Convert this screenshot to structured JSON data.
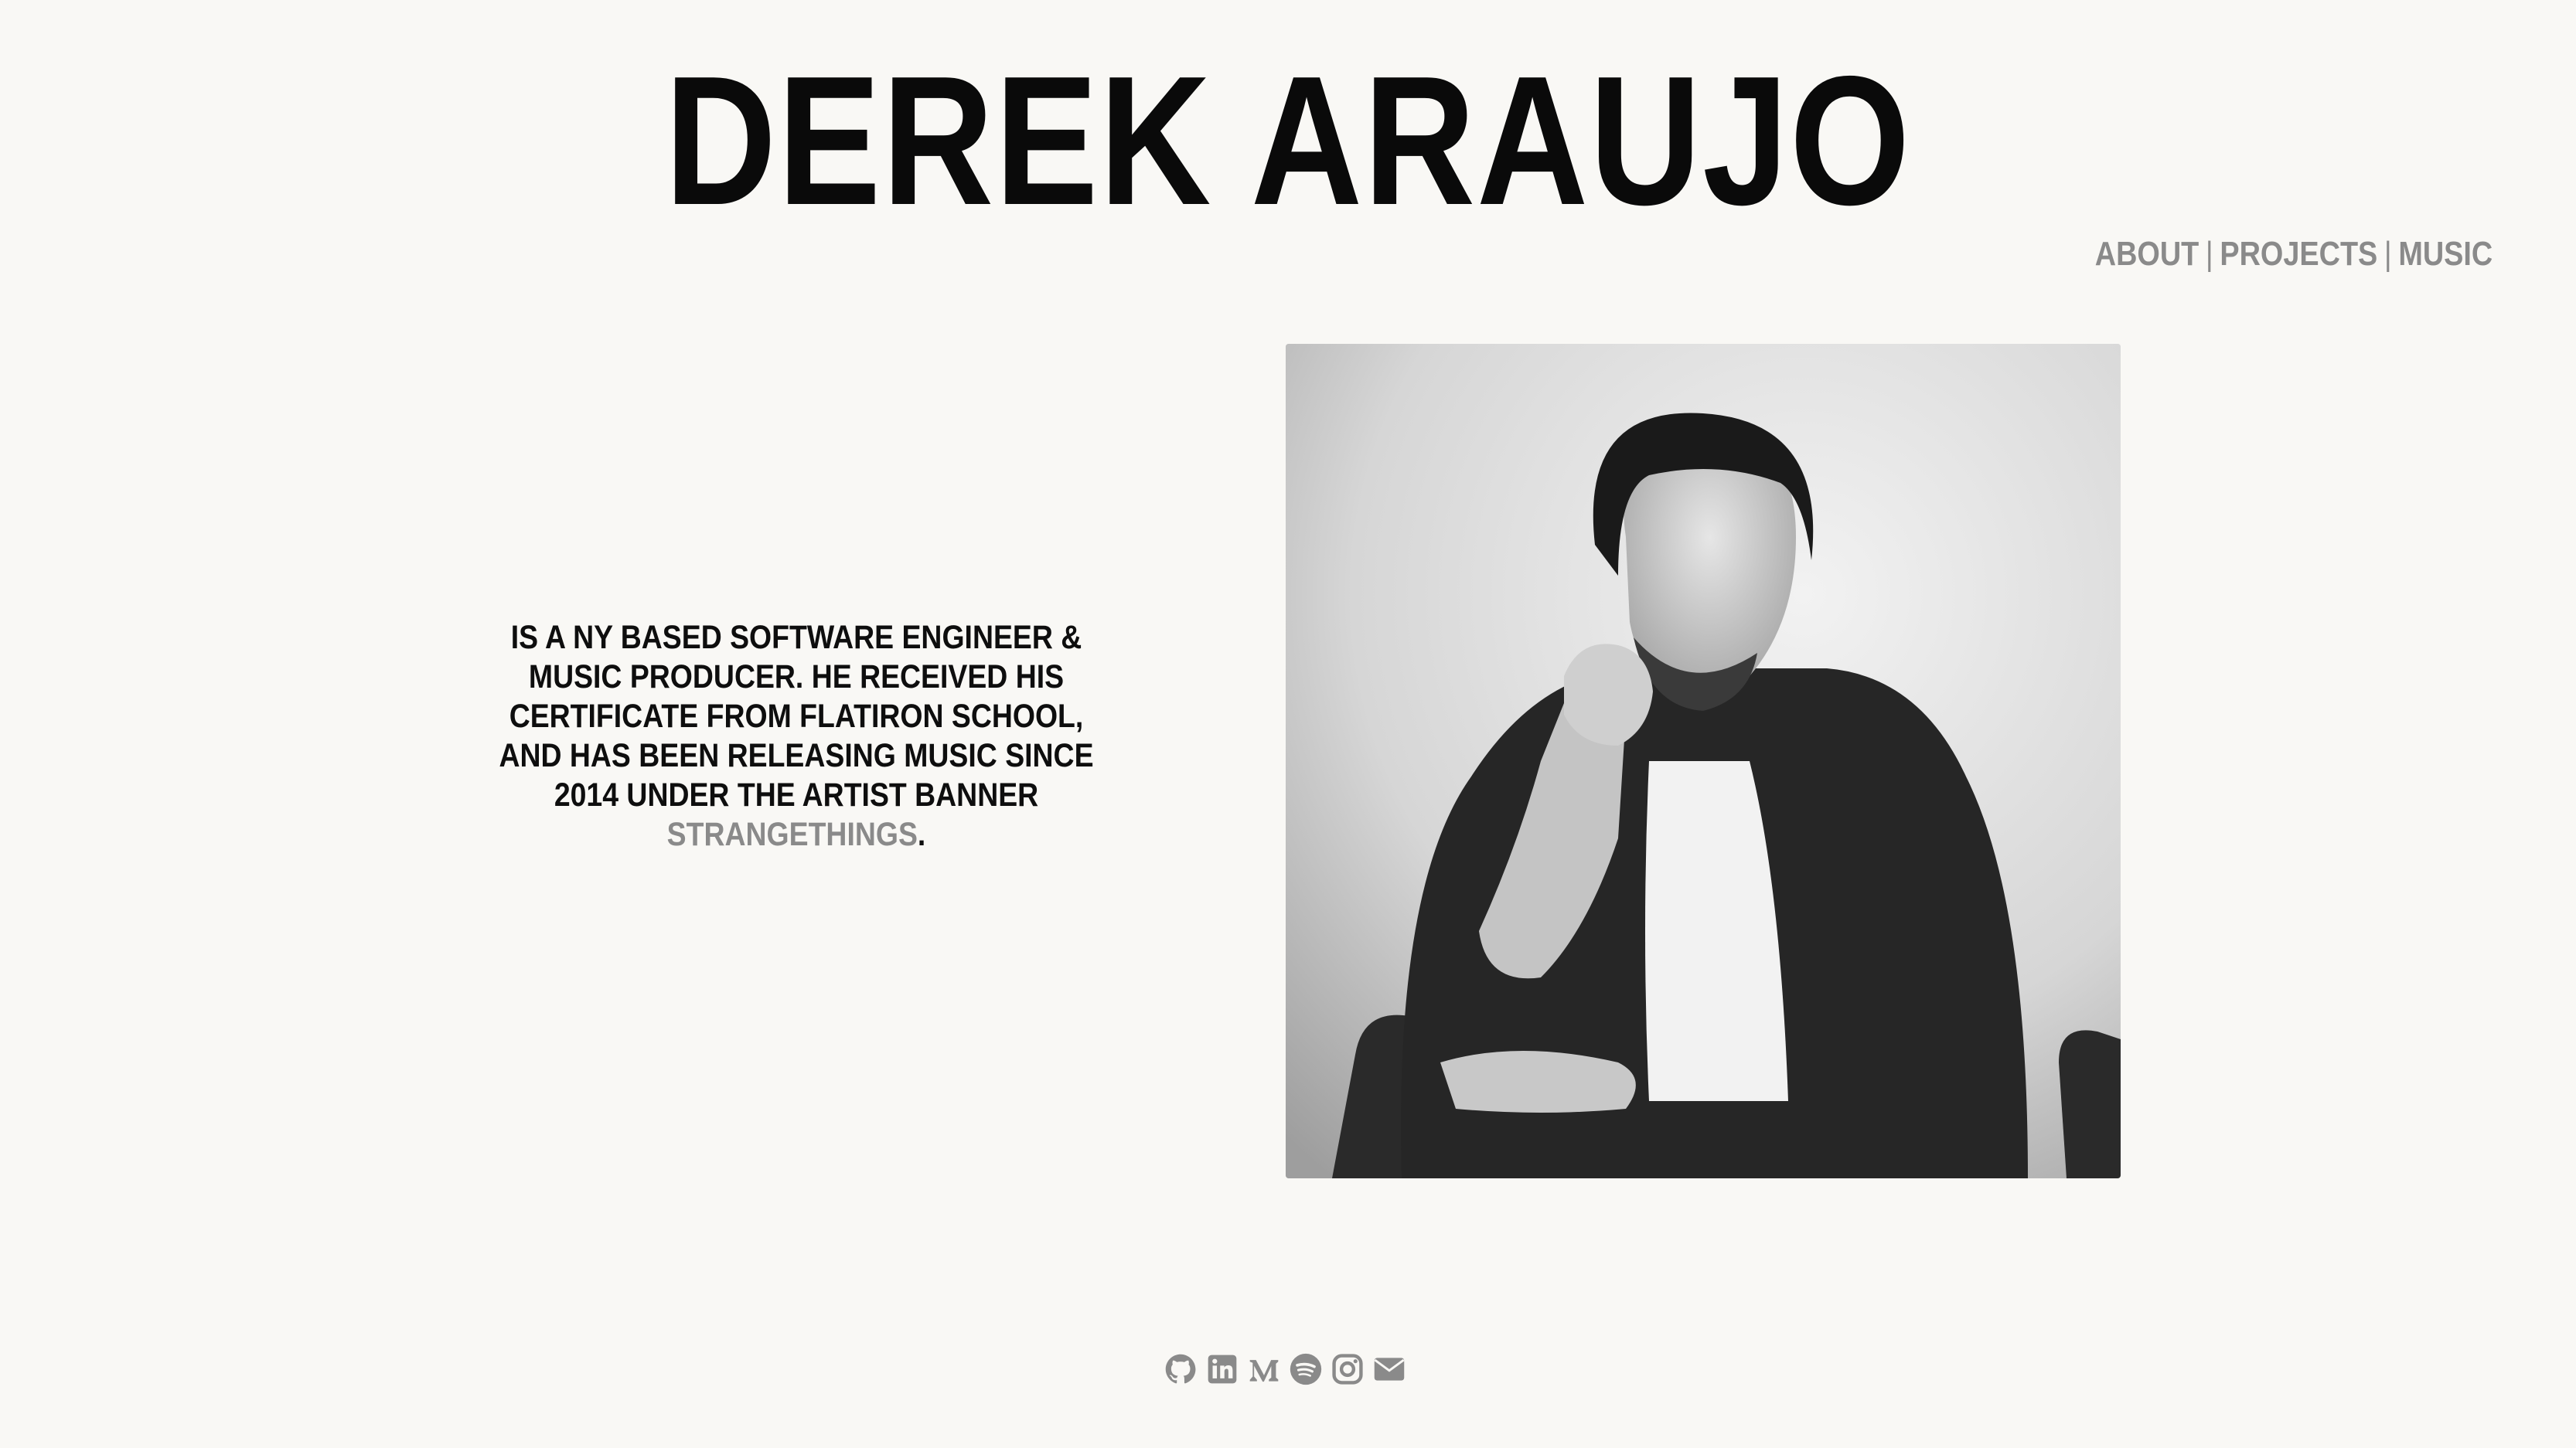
{
  "header": {
    "title": "DEREK ARAUJO"
  },
  "nav": {
    "items": [
      {
        "label": "ABOUT"
      },
      {
        "label": "PROJECTS"
      },
      {
        "label": "MUSIC"
      }
    ],
    "separator": "|"
  },
  "bio": {
    "text": "IS A NY BASED SOFTWARE ENGINEER & MUSIC PRODUCER. HE RECEIVED HIS CERTIFICATE FROM FLATIRON SCHOOL, AND HAS BEEN RELEASING MUSIC SINCE 2014 UNDER THE ARTIST BANNER ",
    "link_label": "STRANGETHINGS",
    "end": "."
  },
  "socials": [
    {
      "icon": "github-icon"
    },
    {
      "icon": "linkedin-icon"
    },
    {
      "icon": "medium-icon"
    },
    {
      "icon": "spotify-icon"
    },
    {
      "icon": "instagram-icon"
    },
    {
      "icon": "envelope-icon"
    }
  ],
  "colors": {
    "background": "#f9f8f5",
    "text": "#0c0c0c",
    "muted": "#8a8a8a"
  }
}
